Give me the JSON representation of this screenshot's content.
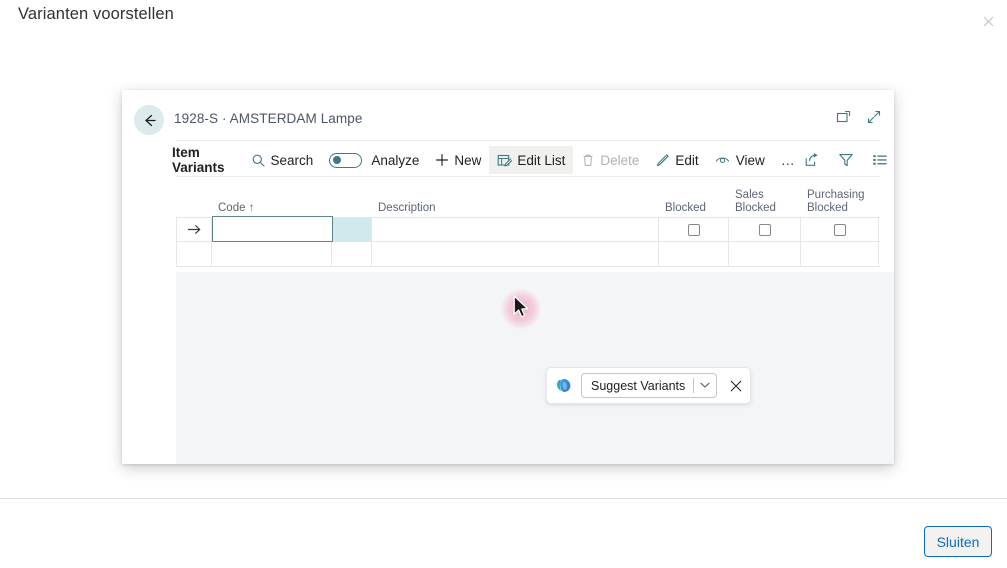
{
  "dialog": {
    "title": "Varianten voorstellen",
    "close_icon": "close-icon",
    "footer_button": "Sluiten"
  },
  "app": {
    "back_icon": "arrow-left-icon",
    "record_title": "1928-S · AMSTERDAM Lampe",
    "header_icons": [
      {
        "name": "open-in-new-window-icon"
      },
      {
        "name": "expand-icon"
      }
    ],
    "toolbar": {
      "title": "Item Variants",
      "items": [
        {
          "label": "Search",
          "icon": "search-icon",
          "state": "normal"
        },
        {
          "label": "Analyze",
          "icon": "toggle-switch",
          "state": "normal"
        },
        {
          "label": "New",
          "icon": "plus-icon",
          "state": "normal"
        },
        {
          "label": "Edit List",
          "icon": "edit-list-icon",
          "state": "active"
        },
        {
          "label": "Delete",
          "icon": "trash-icon",
          "state": "disabled"
        },
        {
          "label": "Edit",
          "icon": "pencil-icon",
          "state": "normal"
        },
        {
          "label": "View",
          "icon": "eye-icon",
          "state": "normal"
        },
        {
          "label": "…",
          "icon": "more-icon",
          "state": "normal"
        }
      ],
      "right_icons": [
        {
          "name": "share-icon"
        },
        {
          "name": "filter-icon"
        },
        {
          "name": "list-view-icon"
        }
      ]
    },
    "grid": {
      "columns": [
        {
          "key": "indicator",
          "label": ""
        },
        {
          "key": "code",
          "label": "Code ↑"
        },
        {
          "key": "spacer",
          "label": ""
        },
        {
          "key": "description",
          "label": "Description"
        },
        {
          "key": "blocked",
          "label": "Blocked"
        },
        {
          "key": "sales_blocked",
          "label_line1": "Sales",
          "label_line2": "Blocked"
        },
        {
          "key": "purchasing_blocked",
          "label_line1": "Purchasing",
          "label_line2": "Blocked"
        }
      ],
      "rows": [
        {
          "indicator": "→",
          "code": "",
          "description": "",
          "blocked": false,
          "sales_blocked": false,
          "purchasing_blocked": false,
          "selected": true
        },
        {
          "indicator": "",
          "code": "",
          "description": "",
          "blocked": null,
          "sales_blocked": null,
          "purchasing_blocked": null,
          "selected": false
        }
      ]
    },
    "copilot_bar": {
      "logo_icon": "copilot-icon",
      "action_label": "Suggest Variants",
      "dropdown_icon": "chevron-down-icon",
      "close_icon": "close-icon"
    }
  },
  "colors": {
    "accent_teal": "#3d7b80",
    "accent_blue": "#0f6cbd",
    "row_highlight": "#cfe9ec",
    "panel_gray": "#f4f5f7",
    "cursor_glow": "#ec407a"
  }
}
